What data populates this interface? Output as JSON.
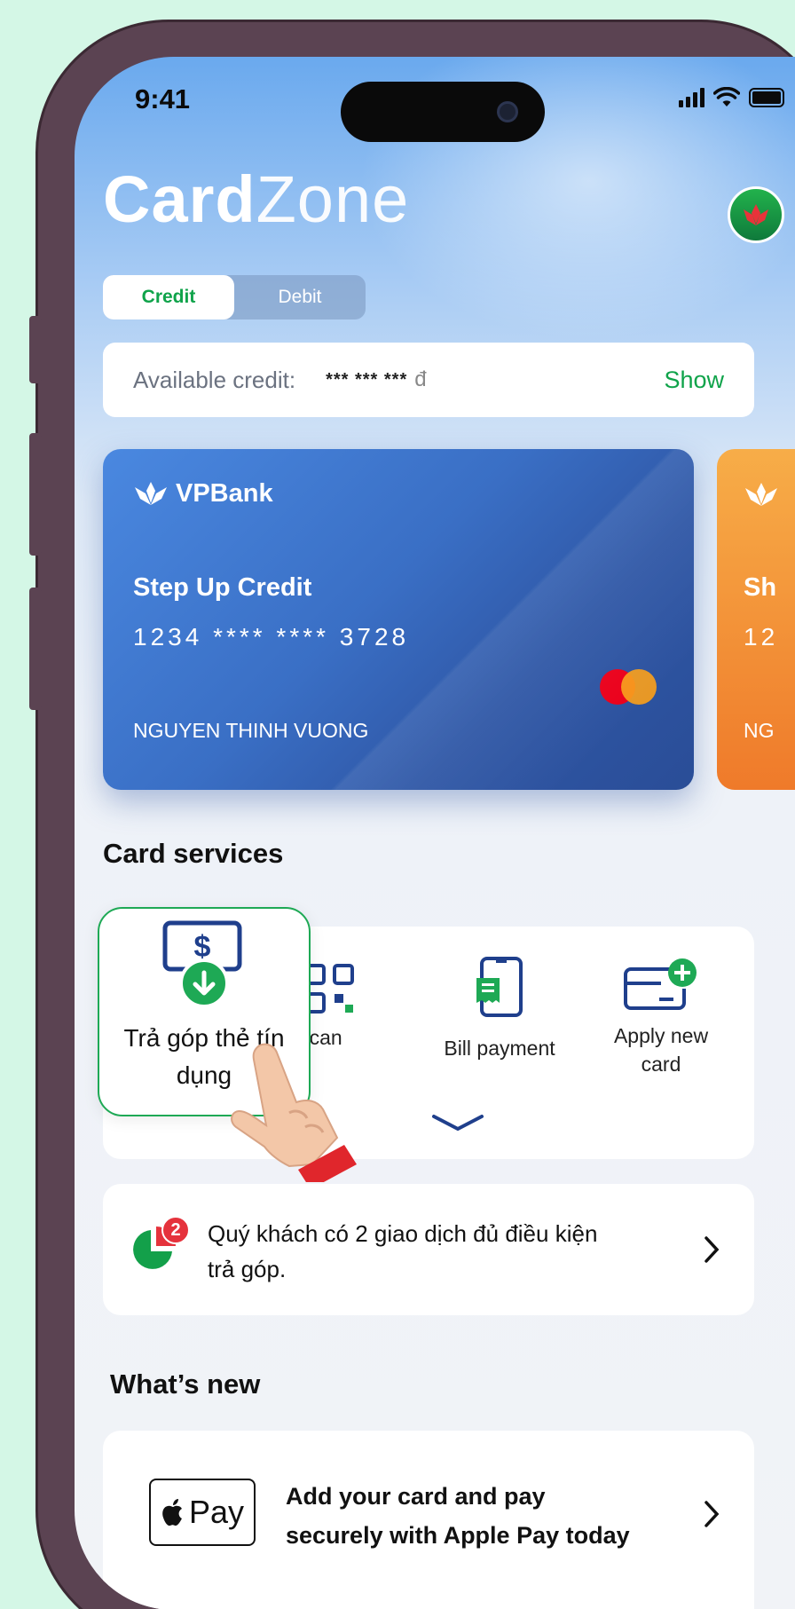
{
  "status_bar": {
    "time": "9:41"
  },
  "header": {
    "logo_bold": "Card",
    "logo_light": "Zone"
  },
  "segment": {
    "tabs": [
      {
        "label": "Credit",
        "active": true
      },
      {
        "label": "Debit",
        "active": false
      }
    ]
  },
  "credit": {
    "label": "Available credit:",
    "value": "*** *** ***",
    "currency": "đ",
    "show_label": "Show"
  },
  "card_primary": {
    "bank": "VPBank",
    "name": "Step Up Credit",
    "number": "1234 **** **** 3728",
    "holder": "NGUYEN THINH VUONG"
  },
  "card_secondary": {
    "name_partial": "Sh",
    "number_partial": "12",
    "holder_partial": "NG"
  },
  "card_services": {
    "title": "Card services",
    "highlighted": {
      "label_line1": "Trả góp thẻ tín",
      "label_line2": "dụng",
      "icon": "installment-dollar-icon"
    },
    "items": [
      {
        "label": "QR scan",
        "icon": "qr-icon"
      },
      {
        "label": "Bill payment",
        "icon": "bill-icon"
      },
      {
        "label_line1": "Apply new",
        "label_line2": "card",
        "icon": "add-card-icon"
      }
    ]
  },
  "promo": {
    "badge": "2",
    "text_line1": "Quý khách có 2 giao dịch đủ điều kiện",
    "text_line2": "trả góp."
  },
  "whats_new": {
    "title": "What’s new",
    "apple_pay_logo": "Pay",
    "text_line1": "Add your card and pay",
    "text_line2": "securely with Apple Pay today"
  },
  "colors": {
    "accent_green": "#0fa34a",
    "card_blue": "#3a6fc5",
    "card_orange": "#f59a3a",
    "badge_red": "#e5323c",
    "icon_blue": "#1f3f8c"
  }
}
